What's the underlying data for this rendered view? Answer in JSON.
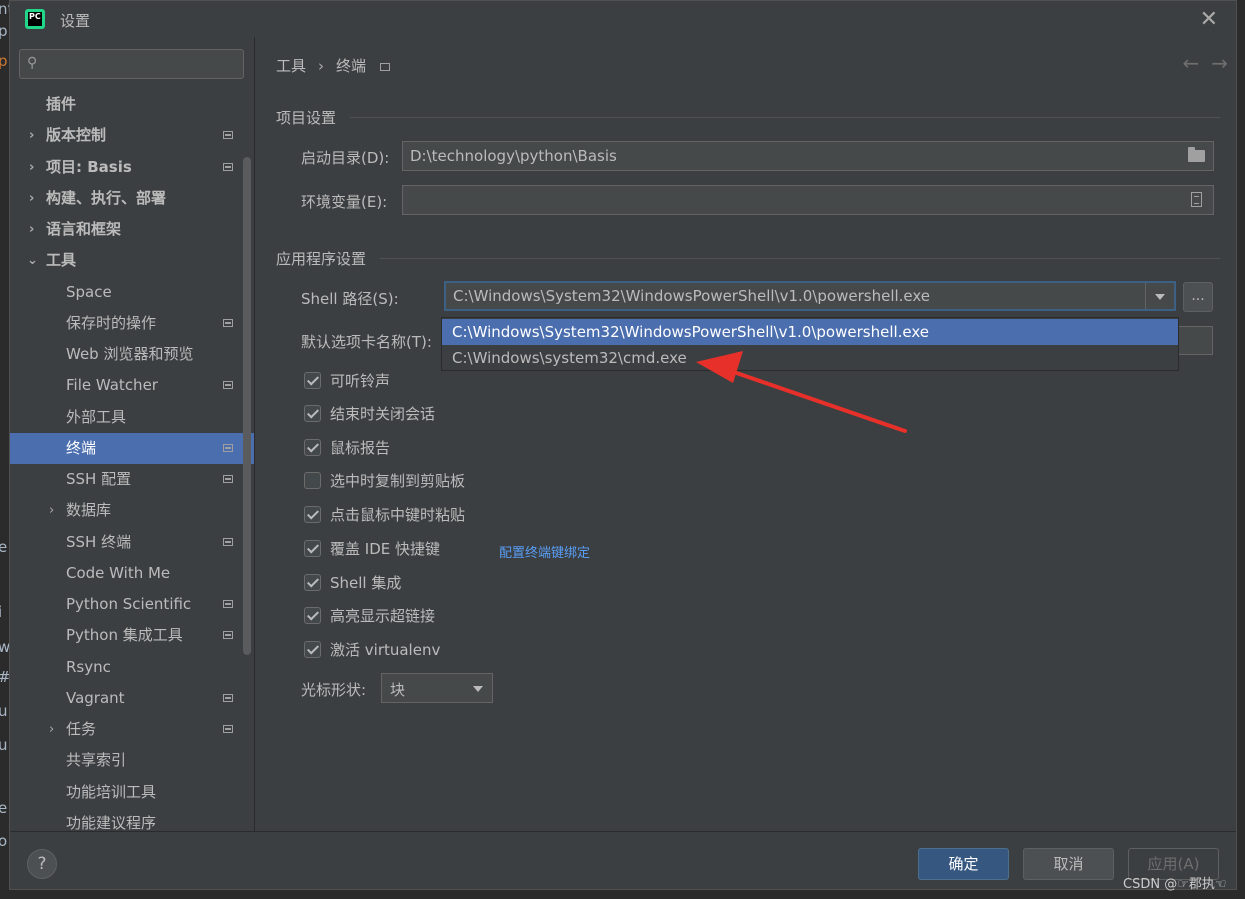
{
  "window": {
    "title": "设置"
  },
  "app_icon_text": "PC",
  "search": {
    "placeholder": ""
  },
  "sidebar": {
    "items": [
      {
        "label": "插件"
      },
      {
        "label": "版本控制"
      },
      {
        "label": "项目: Basis"
      },
      {
        "label": "构建、执行、部署"
      },
      {
        "label": "语言和框架"
      },
      {
        "label": "工具"
      },
      {
        "label": "Space"
      },
      {
        "label": "保存时的操作"
      },
      {
        "label": "Web 浏览器和预览"
      },
      {
        "label": "File Watcher"
      },
      {
        "label": "外部工具"
      },
      {
        "label": "终端"
      },
      {
        "label": "SSH 配置"
      },
      {
        "label": "数据库"
      },
      {
        "label": "SSH 终端"
      },
      {
        "label": "Code With Me"
      },
      {
        "label": "Python Scientific"
      },
      {
        "label": "Python 集成工具"
      },
      {
        "label": "Rsync"
      },
      {
        "label": "Vagrant"
      },
      {
        "label": "任务"
      },
      {
        "label": "共享索引"
      },
      {
        "label": "功能培训工具"
      },
      {
        "label": "功能建议程序"
      }
    ]
  },
  "breadcrumb": {
    "parent": "工具",
    "separator": "›",
    "current": "终端"
  },
  "nav": {
    "back": "←",
    "forward": "→"
  },
  "project_settings": {
    "title": "项目设置",
    "start_dir_label": "启动目录(D):",
    "start_dir_value": "D:\\technology\\python\\Basis",
    "env_label": "环境变量(E):",
    "env_value": ""
  },
  "app_settings": {
    "title": "应用程序设置",
    "shell_label": "Shell 路径(S):",
    "shell_value": "C:\\Windows\\System32\\WindowsPowerShell\\v1.0\\powershell.exe",
    "shell_options": [
      "C:\\Windows\\System32\\WindowsPowerShell\\v1.0\\powershell.exe",
      "C:\\Windows\\system32\\cmd.exe"
    ],
    "more_button": "...",
    "tab_name_label": "默认选项卡名称(T):"
  },
  "checkboxes": [
    {
      "label": "可听铃声",
      "checked": true
    },
    {
      "label": "结束时关闭会话",
      "checked": true
    },
    {
      "label": "鼠标报告",
      "checked": true
    },
    {
      "label": "选中时复制到剪贴板",
      "checked": false
    },
    {
      "label": "点击鼠标中键时粘贴",
      "checked": true
    },
    {
      "label": "覆盖 IDE 快捷键",
      "checked": true,
      "link": "配置终端键绑定"
    },
    {
      "label": "Shell 集成",
      "checked": true
    },
    {
      "label": "高亮显示超链接",
      "checked": true
    },
    {
      "label": "激活 virtualenv",
      "checked": true
    }
  ],
  "cursor": {
    "label": "光标形状:",
    "value": "块"
  },
  "footer": {
    "help": "?",
    "ok": "确定",
    "cancel": "取消",
    "apply": "应用(A)"
  },
  "watermark": "CSDN @☞郡执☜",
  "colors": {
    "selection": "#4b6eaf",
    "accent_button": "#365880",
    "link": "#589df6",
    "annotation_arrow": "#e8302a"
  }
}
